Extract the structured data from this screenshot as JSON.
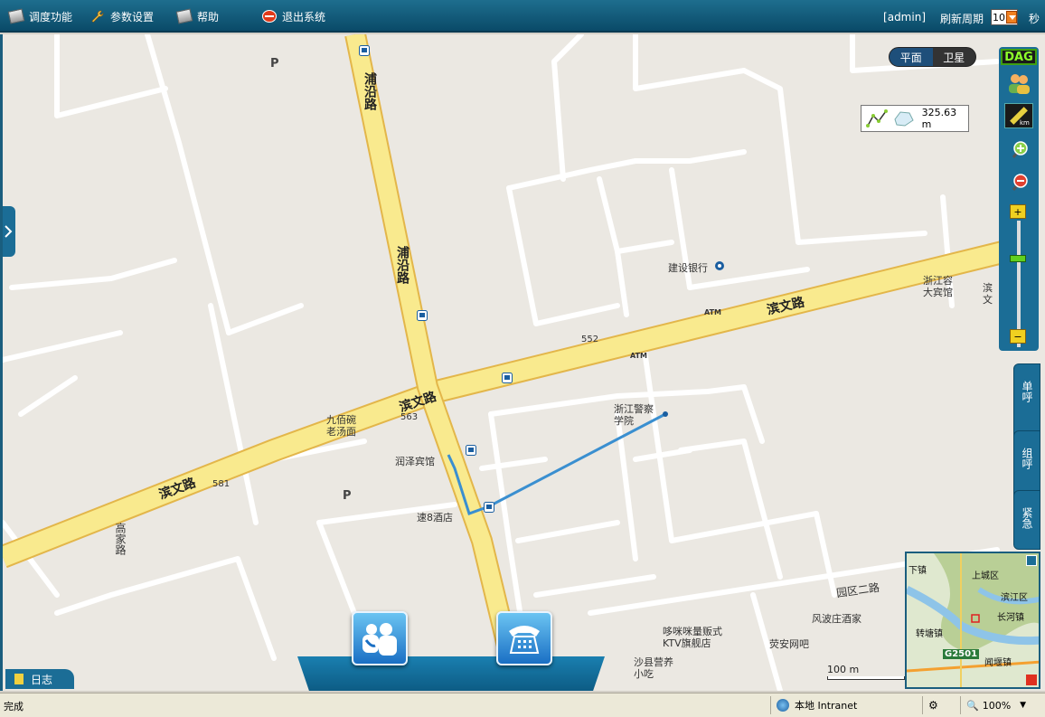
{
  "menu": {
    "items": [
      {
        "label": "调度功能",
        "icon": "dispatch-icon"
      },
      {
        "label": "参数设置",
        "icon": "wrench-icon"
      },
      {
        "label": "帮助",
        "icon": "help-icon"
      },
      {
        "label": "退出系统",
        "icon": "exit-icon"
      }
    ],
    "user": "[admin]",
    "refresh_label": "刷新周期",
    "refresh_value": "10",
    "refresh_unit": "秒"
  },
  "map": {
    "type_options": [
      "平面",
      "卫星"
    ],
    "active_type": "平面",
    "measure_value": "325.63 m",
    "scale_label": "100 m",
    "roads": {
      "binwen_1": "滨文路",
      "binwen_2": "滨文路",
      "binwen_3": "滨文路",
      "puyan_1": "浦沿路",
      "puyan_2": "浦沿路",
      "gaojia": "高家路",
      "yuanqu": "园区二路"
    },
    "route_numbers": [
      "552",
      "563",
      "581"
    ],
    "pois": {
      "ccb": "建设银行",
      "police_school": "浙江警察学院",
      "jiubaiwan": "九佰碗老汤面",
      "runze": "润泽宾馆",
      "suba": "速8酒店",
      "zhejiangrong": "浙江容大宾馆",
      "binwen_hotel": "滨文大酒",
      "ktv": "哆咪咪量贩式KTV旗舰店",
      "fengbo": "风波庄酒家",
      "yingan": "荧安网吧",
      "shaxian": "沙县营养小吃",
      "atm1": "ATM",
      "atm2": "ATM",
      "parking1": "P",
      "parking2": "P"
    },
    "brand": "DAG"
  },
  "side_tabs": [
    "单呼",
    "组呼",
    "紧急"
  ],
  "overview": {
    "labels": [
      "下镇",
      "上城区",
      "滨江区",
      "长河镇",
      "转塘镇",
      "闻堰镇",
      "G2501"
    ]
  },
  "log_tab": "日志",
  "statusbar": {
    "status": "完成",
    "zone": "本地 Intranet",
    "zoom": "100%"
  }
}
